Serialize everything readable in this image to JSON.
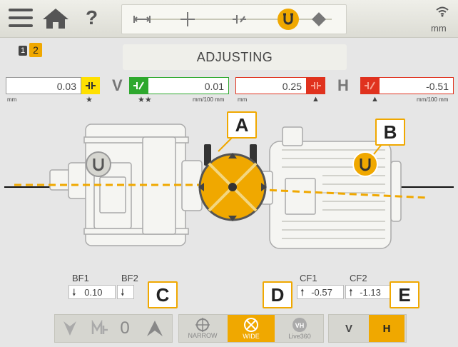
{
  "toolbar": {
    "help_label": "?",
    "unit": "mm"
  },
  "steps": {
    "pages": [
      "1",
      "2"
    ],
    "title": "ADJUSTING"
  },
  "readings": {
    "v_coupling": "0.03",
    "v_angle": "0.01",
    "h_coupling": "0.25",
    "h_angle": "-0.51",
    "v_label": "V",
    "h_label": "H",
    "unit_mm": "mm",
    "unit_mm100": "mm/100 mm"
  },
  "callouts": {
    "a": "A",
    "b": "B",
    "c": "C",
    "d": "D",
    "e": "E"
  },
  "feet": {
    "bf1_label": "BF1",
    "bf2_label": "BF2",
    "cf1_label": "CF1",
    "cf2_label": "CF2",
    "bf1_value": "0.10",
    "cf1_value": "-0.57",
    "cf2_value": "-1.13"
  },
  "controls": {
    "zero_label": "0",
    "narrow_label": "NARROW",
    "wide_label": "WIDE",
    "live_label": "Live360",
    "vh_badge": "VH",
    "v_label": "V",
    "h_label": "H"
  },
  "colors": {
    "accent": "#f0a800",
    "red": "#e0321e",
    "green": "#2ea82e",
    "yellow": "#ffe000"
  }
}
